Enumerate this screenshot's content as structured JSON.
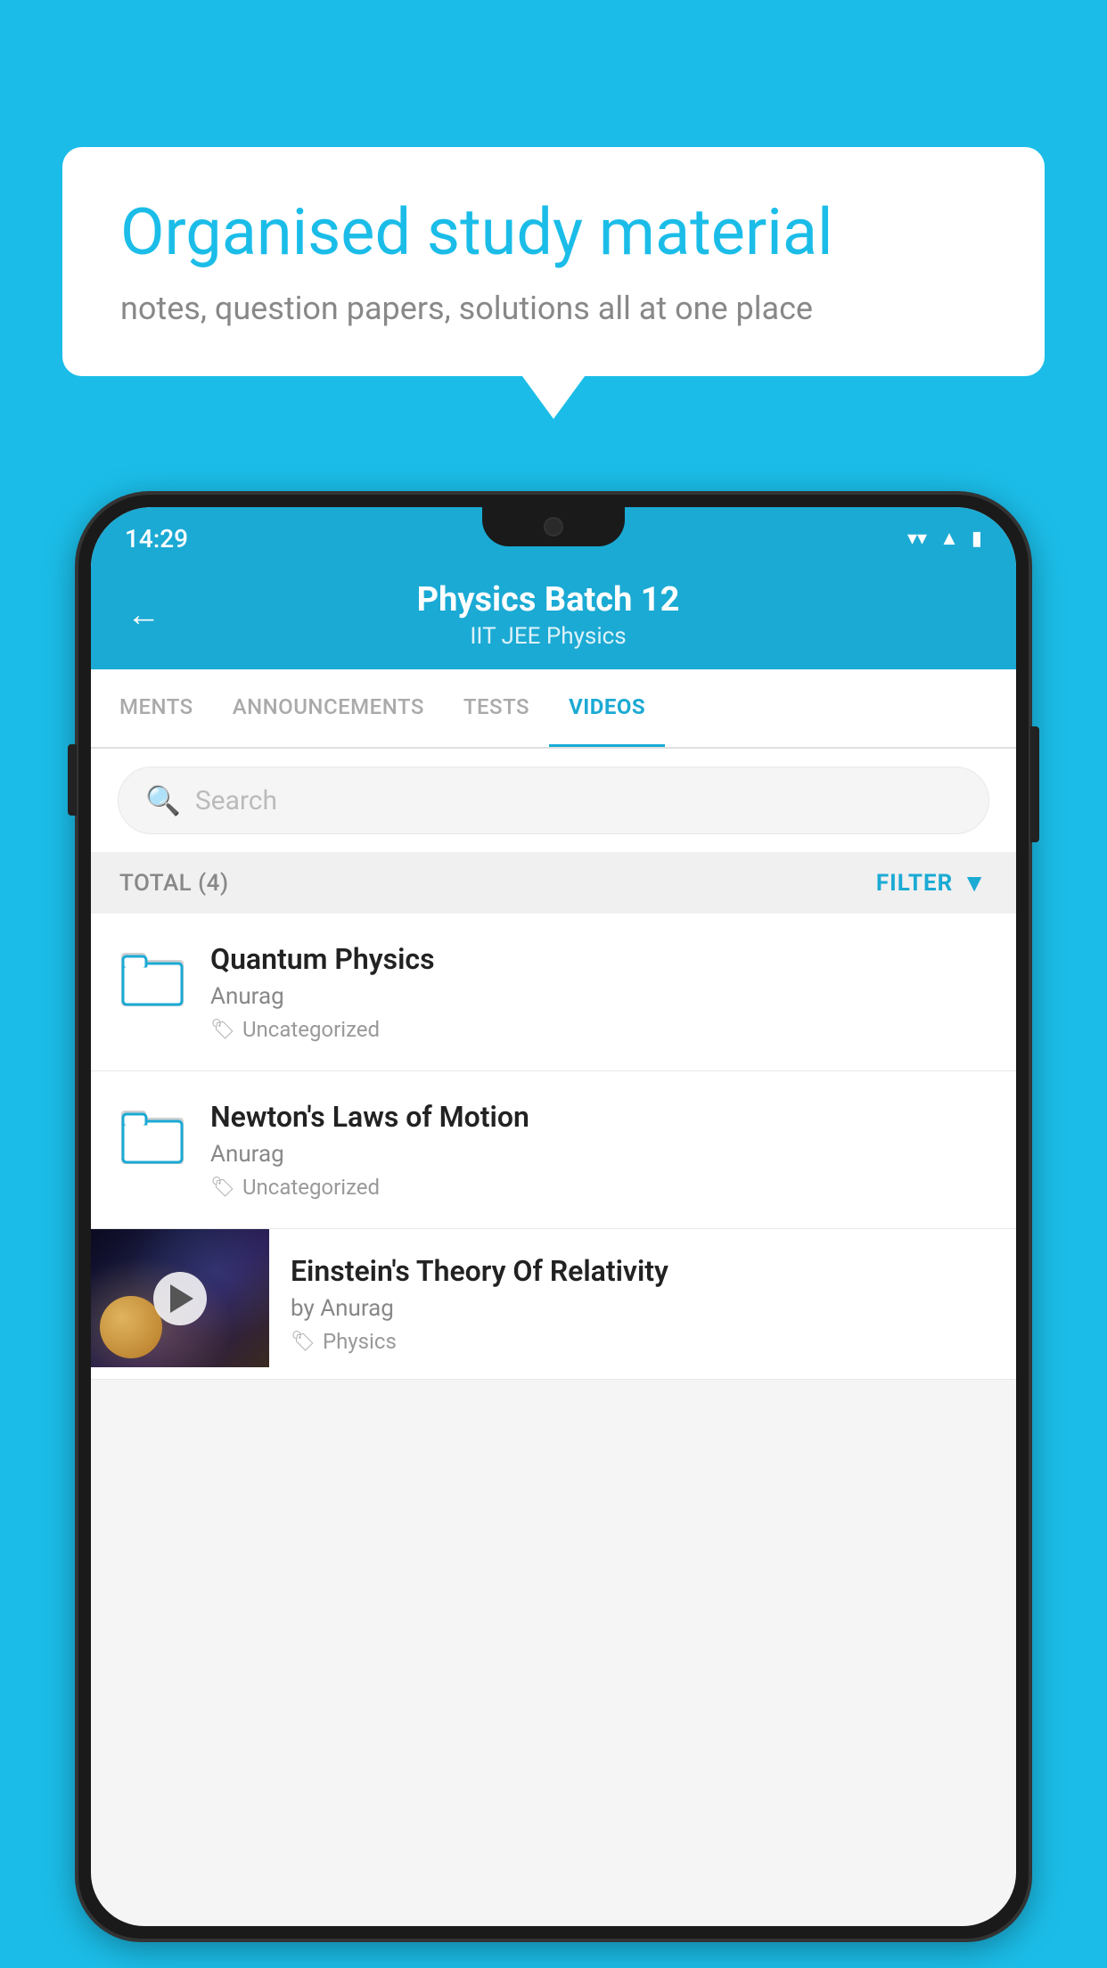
{
  "background_color": "#1bbde8",
  "speech_bubble": {
    "heading": "Organised study material",
    "subtext": "notes, question papers, solutions all at one place"
  },
  "phone": {
    "status_bar": {
      "time": "14:29",
      "wifi": "▾",
      "signal": "▲",
      "battery": "▮"
    },
    "header": {
      "title": "Physics Batch 12",
      "subtitle": "IIT JEE   Physics",
      "back_label": "←"
    },
    "tabs": [
      {
        "label": "MENTS",
        "active": false
      },
      {
        "label": "ANNOUNCEMENTS",
        "active": false
      },
      {
        "label": "TESTS",
        "active": false
      },
      {
        "label": "VIDEOS",
        "active": true
      }
    ],
    "search": {
      "placeholder": "Search"
    },
    "filter_bar": {
      "total_label": "TOTAL (4)",
      "filter_label": "FILTER"
    },
    "items": [
      {
        "type": "folder",
        "title": "Quantum Physics",
        "author": "Anurag",
        "tag": "Uncategorized"
      },
      {
        "type": "folder",
        "title": "Newton's Laws of Motion",
        "author": "Anurag",
        "tag": "Uncategorized"
      },
      {
        "type": "video",
        "title": "Einstein's Theory Of Relativity",
        "author": "by Anurag",
        "tag": "Physics"
      }
    ]
  }
}
